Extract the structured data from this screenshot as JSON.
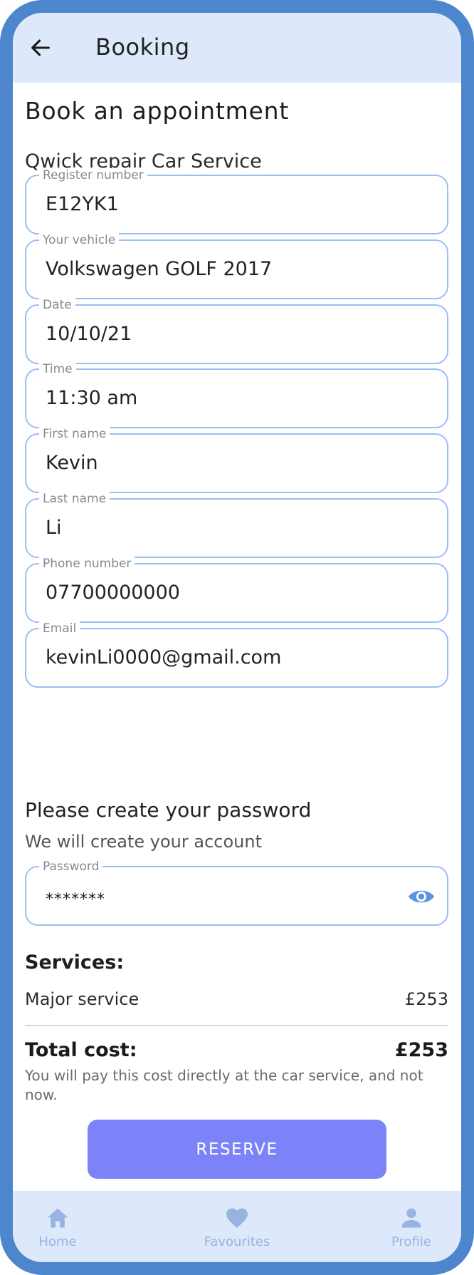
{
  "app_bar": {
    "back_icon": "arrow-left-icon",
    "title": "Booking"
  },
  "page": {
    "title": "Book an appointment",
    "service_name": "Qwick repair Car Service"
  },
  "fields": {
    "register_number": {
      "label": "Register number",
      "value": "E12YK1"
    },
    "vehicle": {
      "label": "Your vehicle",
      "value": "Volkswagen GOLF 2017"
    },
    "date": {
      "label": "Date",
      "value": "10/10/21"
    },
    "time": {
      "label": "Time",
      "value": "11:30 am"
    },
    "first_name": {
      "label": "First name",
      "value": "Kevin"
    },
    "last_name": {
      "label": "Last name",
      "value": "Li"
    },
    "phone": {
      "label": "Phone number",
      "value": "07700000000"
    },
    "email": {
      "label": "Email",
      "value": "kevinLi0000@gmail.com"
    }
  },
  "password_section": {
    "heading": "Please create your password",
    "subheading": "We will create your account",
    "password": {
      "label": "Password",
      "value": "*******",
      "toggle_icon": "eye-icon"
    }
  },
  "services": {
    "title": "Services:",
    "items": [
      {
        "name": "Major service",
        "price": "£253"
      }
    ]
  },
  "total": {
    "label": "Total cost:",
    "value": "£253",
    "note": "You will pay this cost directly at the car service, and not now."
  },
  "actions": {
    "reserve_label": "RESERVE"
  },
  "bottom_nav": {
    "items": [
      {
        "label": "Home",
        "icon": "home-icon"
      },
      {
        "label": "Favourites",
        "icon": "heart-icon"
      },
      {
        "label": "Profile",
        "icon": "person-icon"
      }
    ]
  },
  "colors": {
    "frame": "#4d86cc",
    "header_background": "#dde8fb",
    "field_border": "#9bbff0",
    "primary_button": "#7c82f7",
    "nav_inactive": "#97b3e0",
    "eye_icon": "#5a93e0"
  }
}
